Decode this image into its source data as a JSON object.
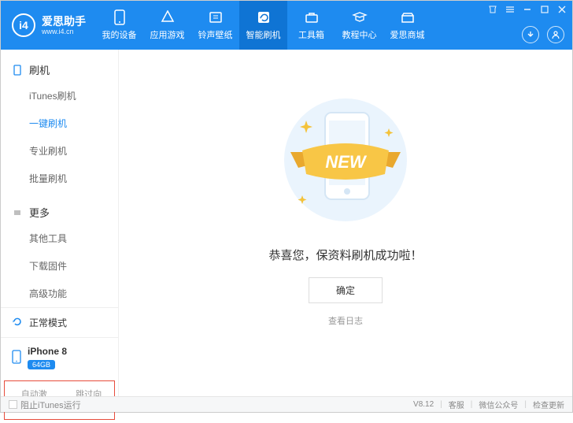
{
  "app": {
    "title": "爱思助手",
    "subtitle": "www.i4.cn",
    "logo_text": "i4"
  },
  "nav": [
    {
      "label": "我的设备"
    },
    {
      "label": "应用游戏"
    },
    {
      "label": "铃声壁纸"
    },
    {
      "label": "智能刷机"
    },
    {
      "label": "工具箱"
    },
    {
      "label": "教程中心"
    },
    {
      "label": "爱思商城"
    }
  ],
  "sidebar": {
    "section1": {
      "title": "刷机",
      "items": [
        "iTunes刷机",
        "一键刷机",
        "专业刷机",
        "批量刷机"
      ]
    },
    "section2": {
      "title": "更多",
      "items": [
        "其他工具",
        "下载固件",
        "高级功能"
      ]
    },
    "mode": "正常模式",
    "device": {
      "name": "iPhone 8",
      "storage": "64GB"
    },
    "opts": {
      "auto": "自动激活",
      "skip": "跳过向导"
    }
  },
  "main": {
    "ribbon": "NEW",
    "message": "恭喜您，保资料刷机成功啦！",
    "ok": "确定",
    "log": "查看日志"
  },
  "footer": {
    "block_itunes": "阻止iTunes运行",
    "version": "V8.12",
    "support": "客服",
    "wechat": "微信公众号",
    "update": "检查更新"
  }
}
